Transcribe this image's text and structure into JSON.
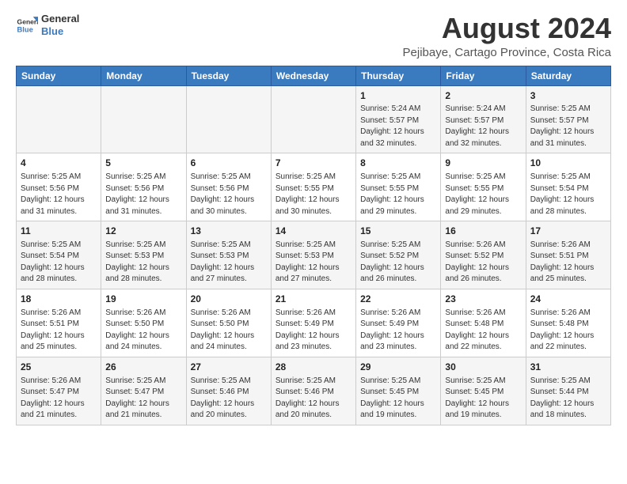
{
  "logo": {
    "name_line1": "General",
    "name_line2": "Blue"
  },
  "title": {
    "month_year": "August 2024",
    "location": "Pejibaye, Cartago Province, Costa Rica"
  },
  "weekdays": [
    "Sunday",
    "Monday",
    "Tuesday",
    "Wednesday",
    "Thursday",
    "Friday",
    "Saturday"
  ],
  "weeks": [
    [
      {
        "day": "",
        "info": ""
      },
      {
        "day": "",
        "info": ""
      },
      {
        "day": "",
        "info": ""
      },
      {
        "day": "",
        "info": ""
      },
      {
        "day": "1",
        "info": "Sunrise: 5:24 AM\nSunset: 5:57 PM\nDaylight: 12 hours\nand 32 minutes."
      },
      {
        "day": "2",
        "info": "Sunrise: 5:24 AM\nSunset: 5:57 PM\nDaylight: 12 hours\nand 32 minutes."
      },
      {
        "day": "3",
        "info": "Sunrise: 5:25 AM\nSunset: 5:57 PM\nDaylight: 12 hours\nand 31 minutes."
      }
    ],
    [
      {
        "day": "4",
        "info": "Sunrise: 5:25 AM\nSunset: 5:56 PM\nDaylight: 12 hours\nand 31 minutes."
      },
      {
        "day": "5",
        "info": "Sunrise: 5:25 AM\nSunset: 5:56 PM\nDaylight: 12 hours\nand 31 minutes."
      },
      {
        "day": "6",
        "info": "Sunrise: 5:25 AM\nSunset: 5:56 PM\nDaylight: 12 hours\nand 30 minutes."
      },
      {
        "day": "7",
        "info": "Sunrise: 5:25 AM\nSunset: 5:55 PM\nDaylight: 12 hours\nand 30 minutes."
      },
      {
        "day": "8",
        "info": "Sunrise: 5:25 AM\nSunset: 5:55 PM\nDaylight: 12 hours\nand 29 minutes."
      },
      {
        "day": "9",
        "info": "Sunrise: 5:25 AM\nSunset: 5:55 PM\nDaylight: 12 hours\nand 29 minutes."
      },
      {
        "day": "10",
        "info": "Sunrise: 5:25 AM\nSunset: 5:54 PM\nDaylight: 12 hours\nand 28 minutes."
      }
    ],
    [
      {
        "day": "11",
        "info": "Sunrise: 5:25 AM\nSunset: 5:54 PM\nDaylight: 12 hours\nand 28 minutes."
      },
      {
        "day": "12",
        "info": "Sunrise: 5:25 AM\nSunset: 5:53 PM\nDaylight: 12 hours\nand 28 minutes."
      },
      {
        "day": "13",
        "info": "Sunrise: 5:25 AM\nSunset: 5:53 PM\nDaylight: 12 hours\nand 27 minutes."
      },
      {
        "day": "14",
        "info": "Sunrise: 5:25 AM\nSunset: 5:53 PM\nDaylight: 12 hours\nand 27 minutes."
      },
      {
        "day": "15",
        "info": "Sunrise: 5:25 AM\nSunset: 5:52 PM\nDaylight: 12 hours\nand 26 minutes."
      },
      {
        "day": "16",
        "info": "Sunrise: 5:26 AM\nSunset: 5:52 PM\nDaylight: 12 hours\nand 26 minutes."
      },
      {
        "day": "17",
        "info": "Sunrise: 5:26 AM\nSunset: 5:51 PM\nDaylight: 12 hours\nand 25 minutes."
      }
    ],
    [
      {
        "day": "18",
        "info": "Sunrise: 5:26 AM\nSunset: 5:51 PM\nDaylight: 12 hours\nand 25 minutes."
      },
      {
        "day": "19",
        "info": "Sunrise: 5:26 AM\nSunset: 5:50 PM\nDaylight: 12 hours\nand 24 minutes."
      },
      {
        "day": "20",
        "info": "Sunrise: 5:26 AM\nSunset: 5:50 PM\nDaylight: 12 hours\nand 24 minutes."
      },
      {
        "day": "21",
        "info": "Sunrise: 5:26 AM\nSunset: 5:49 PM\nDaylight: 12 hours\nand 23 minutes."
      },
      {
        "day": "22",
        "info": "Sunrise: 5:26 AM\nSunset: 5:49 PM\nDaylight: 12 hours\nand 23 minutes."
      },
      {
        "day": "23",
        "info": "Sunrise: 5:26 AM\nSunset: 5:48 PM\nDaylight: 12 hours\nand 22 minutes."
      },
      {
        "day": "24",
        "info": "Sunrise: 5:26 AM\nSunset: 5:48 PM\nDaylight: 12 hours\nand 22 minutes."
      }
    ],
    [
      {
        "day": "25",
        "info": "Sunrise: 5:26 AM\nSunset: 5:47 PM\nDaylight: 12 hours\nand 21 minutes."
      },
      {
        "day": "26",
        "info": "Sunrise: 5:25 AM\nSunset: 5:47 PM\nDaylight: 12 hours\nand 21 minutes."
      },
      {
        "day": "27",
        "info": "Sunrise: 5:25 AM\nSunset: 5:46 PM\nDaylight: 12 hours\nand 20 minutes."
      },
      {
        "day": "28",
        "info": "Sunrise: 5:25 AM\nSunset: 5:46 PM\nDaylight: 12 hours\nand 20 minutes."
      },
      {
        "day": "29",
        "info": "Sunrise: 5:25 AM\nSunset: 5:45 PM\nDaylight: 12 hours\nand 19 minutes."
      },
      {
        "day": "30",
        "info": "Sunrise: 5:25 AM\nSunset: 5:45 PM\nDaylight: 12 hours\nand 19 minutes."
      },
      {
        "day": "31",
        "info": "Sunrise: 5:25 AM\nSunset: 5:44 PM\nDaylight: 12 hours\nand 18 minutes."
      }
    ]
  ]
}
